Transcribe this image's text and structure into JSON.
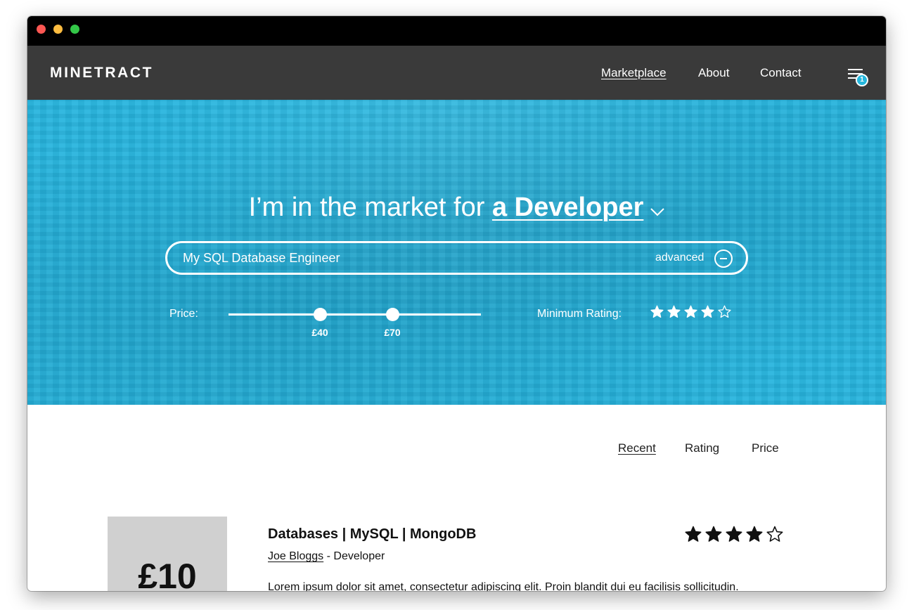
{
  "nav": {
    "logo": "MINETRACT",
    "links": [
      {
        "label": "Marketplace",
        "active": true
      },
      {
        "label": "About",
        "active": false
      },
      {
        "label": "Contact",
        "active": false
      }
    ],
    "menu_icon": "hamburger-menu-icon",
    "notification_count": "1"
  },
  "hero": {
    "headline_prefix": "I’m in the market for ",
    "headline_role": "a Developer",
    "search": {
      "value": "My SQL Database Engineer",
      "advanced_label": "advanced",
      "advanced_icon": "minus-circle-icon"
    },
    "filters": {
      "price_label": "Price:",
      "price_min": "£40",
      "price_max": "£70",
      "price_min_fraction": 0.36,
      "price_max_fraction": 0.65,
      "rating_label": "Minimum Rating:",
      "rating_value": 4,
      "rating_max": 5
    }
  },
  "sort": {
    "options": [
      {
        "label": "Recent",
        "active": true
      },
      {
        "label": "Rating",
        "active": false
      },
      {
        "label": "Price",
        "active": false
      }
    ]
  },
  "listings": [
    {
      "price": "£10",
      "title": "Databases | MySQL | MongoDB",
      "author": "Joe Bloggs",
      "role_suffix": " - Developer",
      "rating": 4,
      "rating_max": 5,
      "description": "Lorem ipsum dolor sit amet, consectetur adipiscing elit. Proin blandit dui eu facilisis sollicitudin."
    }
  ],
  "colors": {
    "accent": "#29b6de",
    "navbar": "#3a3a3a",
    "titlebar": "#000000",
    "price_box": "#d0d0d0"
  }
}
